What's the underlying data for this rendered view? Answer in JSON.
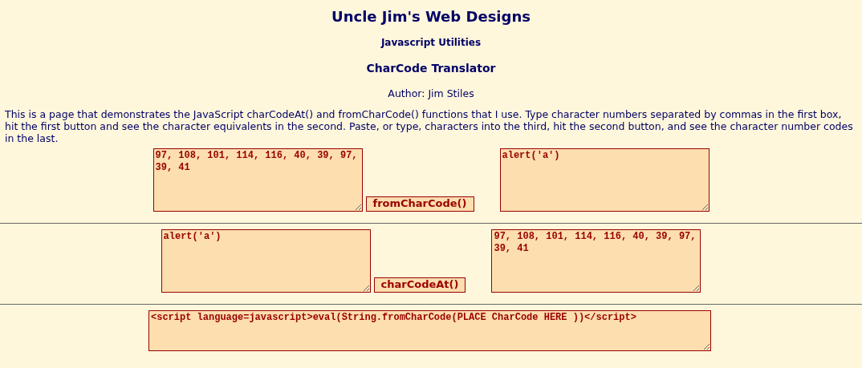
{
  "title": "Uncle Jim's Web Designs",
  "subtitle": "Javascript Utilities",
  "heading": "CharCode Translator",
  "author": "Author: Jim Stiles",
  "intro": "This is a page that demonstrates the JavaScript charCodeAt() and fromCharCode() functions that I use. Type character numbers separated by commas in the first box, hit the first button and see the character equivalents in the second. Paste, or type, characters into the third, hit the second button, and see the character number codes in the last.",
  "converters": [
    {
      "input": "97, 108, 101, 114, 116, 40, 39, 97, 39, 41",
      "button": "fromCharCode()",
      "output": "alert('a')"
    },
    {
      "input": "alert('a')",
      "button": "charCodeAt()",
      "output": "97, 108, 101, 114, 116, 40, 39, 97, 39, 41"
    }
  ],
  "template": "<script language=javascript>eval(String.fromCharCode(PLACE CharCode HERE ))</script>"
}
